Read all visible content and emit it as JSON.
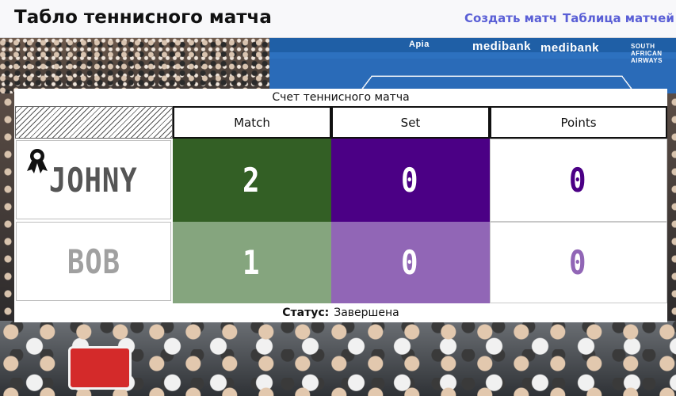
{
  "header": {
    "title": "Табло теннисного матча",
    "nav": [
      {
        "label": "Создать матч"
      },
      {
        "label": "Таблица матчей"
      }
    ]
  },
  "backdrop": {
    "banners": [
      "Apia",
      "medibank",
      "medibank",
      "SOUTH AFRICAN AIRWAYS"
    ]
  },
  "scoreboard": {
    "title": "Счет теннисного матча",
    "columns": [
      "Match",
      "Set",
      "Points"
    ],
    "players": [
      {
        "name": "JOHNY",
        "match": "2",
        "set": "0",
        "points": "0",
        "winner": true
      },
      {
        "name": "BOB",
        "match": "1",
        "set": "0",
        "points": "0",
        "winner": false
      }
    ],
    "status_label": "Статус:",
    "status_value": "Завершена"
  },
  "colors": {
    "match_row1": "#335f25",
    "match_row2": "#85a57e",
    "set_row1": "#4b0085",
    "set_row2": "#9166b6",
    "points_row1_digit": "#4b0085",
    "points_row2_digit": "#9166b6",
    "name_row1": "#555555",
    "name_row2": "#a0a0a0",
    "nav_link": "#5a5fd6"
  },
  "icons": {
    "winner": "award-ribbon-icon"
  }
}
